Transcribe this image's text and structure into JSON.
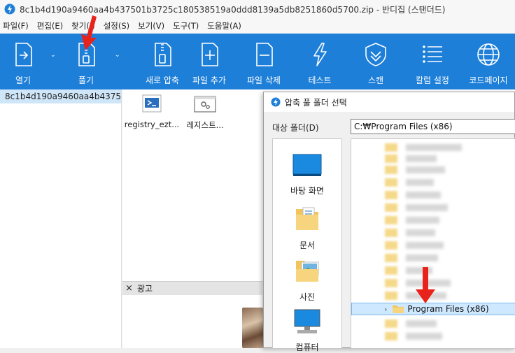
{
  "window": {
    "title": "8c1b4d190a9460aa4b437501b3725c180538519a0ddd8139a5db8251860d5700.zip - 반디집 (스탠더드)"
  },
  "menu": [
    "파일(F)",
    "편집(E)",
    "찾기(I)",
    "설정(S)",
    "보기(V)",
    "도구(T)",
    "도움말(A)"
  ],
  "toolbar": {
    "open": "열기",
    "extract": "풀기",
    "new_archive": "새로 압축",
    "add_files": "파일 추가",
    "delete_files": "파일 삭제",
    "test": "테스트",
    "scan": "스캔",
    "column_settings": "칼럼 설정",
    "codepage": "코드페이지"
  },
  "tree": {
    "archive_name": "8c1b4d190a9460aa4b4375"
  },
  "files": [
    {
      "name": "registry_ezt...",
      "icon": "powershell-script-icon"
    },
    {
      "name": "레지스트...",
      "icon": "registry-file-icon"
    }
  ],
  "ad": {
    "label": "광고",
    "close": "×"
  },
  "dialog": {
    "title": "압축 풀 폴더 선택",
    "target_label": "대상 폴더(D)",
    "path_value": "C:₩Program Files (x86)",
    "places": [
      "바탕 화면",
      "문서",
      "사진",
      "컴퓨터"
    ],
    "selected_folder": "Program Files (x86)"
  },
  "colors": {
    "toolbar": "#1e7fd9",
    "arrow": "#e8231b",
    "selection": "#cde8ff"
  }
}
